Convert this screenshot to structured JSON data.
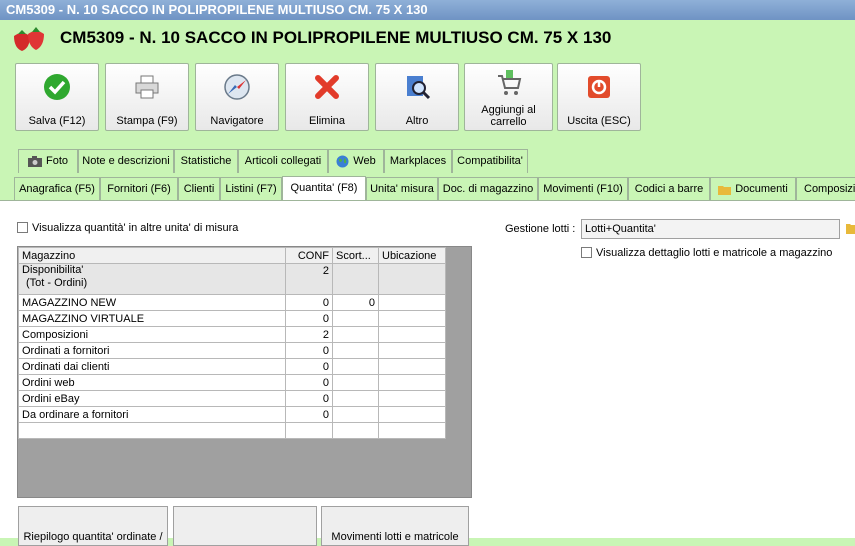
{
  "window": {
    "title": "CM5309 - N. 10 SACCO IN POLIPROPILENE MULTIUSO CM. 75 X 130"
  },
  "header": {
    "title": "CM5309 - N. 10 SACCO IN POLIPROPILENE MULTIUSO CM. 75 X 130"
  },
  "toolbar": {
    "save": "Salva (F12)",
    "print": "Stampa (F9)",
    "navigator": "Navigatore",
    "delete": "Elimina",
    "other": "Altro",
    "add_cart": "Aggiungi al carrello",
    "exit": "Uscita (ESC)"
  },
  "tabs_top": [
    "Foto",
    "Note e descrizioni",
    "Statistiche",
    "Articoli collegati",
    "Web",
    "Markplaces",
    "Compatibilita'"
  ],
  "tabs_bottom": [
    "Anagrafica (F5)",
    "Fornitori (F6)",
    "Clienti",
    "Listini (F7)",
    "Quantita' (F8)",
    "Unita' misura",
    "Doc. di magazzino",
    "Movimenti (F10)",
    "Codici a barre",
    "Documenti",
    "Composizi"
  ],
  "options": {
    "show_other_units": "Visualizza quantità' in altre unita' di misura",
    "lots_label": "Gestione lotti :",
    "lots_value": "Lotti+Quantita'",
    "show_lot_detail": "Visualizza dettaglio lotti e matricole a magazzino"
  },
  "grid": {
    "headers": [
      "Magazzino",
      "CONF",
      "Scort...",
      "Ubicazione"
    ],
    "rows": [
      {
        "name": "Disponibilita'",
        "name2": "(Tot - Ordini)",
        "conf": "2",
        "scort": "",
        "ubic": ""
      },
      {
        "name": "MAGAZZINO NEW",
        "conf": "0",
        "scort": "0",
        "ubic": ""
      },
      {
        "name": "MAGAZZINO VIRTUALE",
        "conf": "0",
        "scort": "",
        "ubic": ""
      },
      {
        "name": "Composizioni",
        "conf": "2",
        "scort": "",
        "ubic": ""
      },
      {
        "name": "Ordinati a fornitori",
        "conf": "0",
        "scort": "",
        "ubic": ""
      },
      {
        "name": "Ordinati dai clienti",
        "conf": "0",
        "scort": "",
        "ubic": ""
      },
      {
        "name": "Ordini web",
        "conf": "0",
        "scort": "",
        "ubic": ""
      },
      {
        "name": "Ordini eBay",
        "conf": "0",
        "scort": "",
        "ubic": ""
      },
      {
        "name": "Da ordinare a fornitori",
        "conf": "0",
        "scort": "",
        "ubic": ""
      }
    ]
  },
  "bottom_buttons": [
    "Riepilogo quantita' ordinate / ...",
    "",
    "Movimenti lotti e matricole"
  ],
  "colors": {
    "bg": "#c9f5b5",
    "titlebar": "#7a9ccb"
  }
}
